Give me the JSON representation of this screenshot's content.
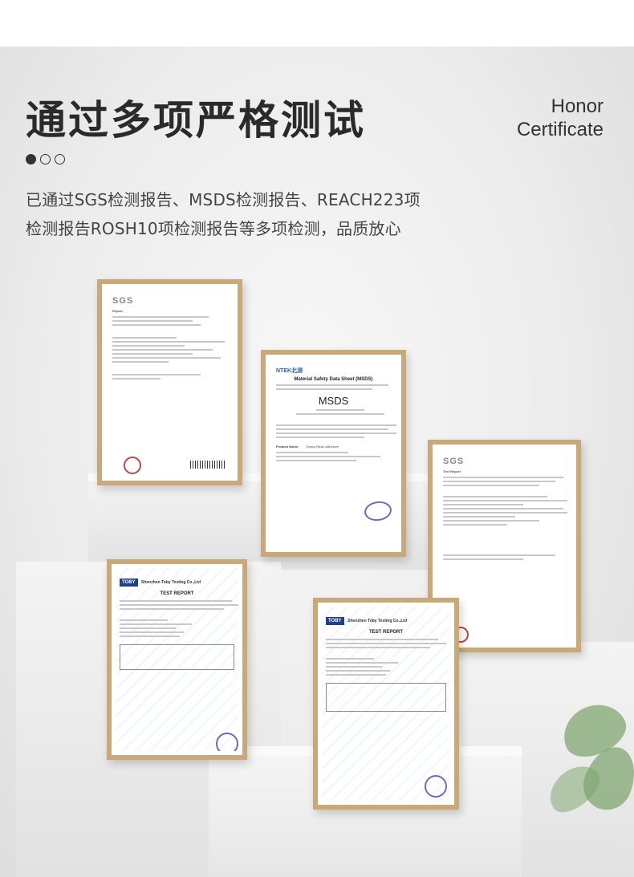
{
  "header": {
    "title": "通过多项严格测试",
    "honor_line1": "Honor",
    "honor_line2": "Certificate",
    "pagination": {
      "total": 3,
      "active": 1
    }
  },
  "description": {
    "line1": "已通过SGS检测报告、MSDS检测报告、REACH223项",
    "line2": "检测报告ROSH10项检测报告等多项检测，品质放心"
  },
  "certificates": {
    "sgs_report": {
      "logo": "SGS",
      "label": "Report"
    },
    "msds": {
      "logo": "NTEK北测",
      "heading": "Material Safety Data Sheet (MSDS)",
      "big": "MSDS",
      "product_label": "Product Name:",
      "product_value": "Epoxy Resin Adhesive"
    },
    "sgs_test": {
      "logo": "SGS",
      "label": "Test Report"
    },
    "toby_left": {
      "logo": "TOBY",
      "company": "Shenzhen Toby Testing Co.,Ltd",
      "heading": "TEST REPORT"
    },
    "toby_right": {
      "logo": "TOBY",
      "company": "Shenzhen Toby Testing Co.,Ltd",
      "heading": "TEST REPORT"
    }
  },
  "colors": {
    "frame": "#c9a978",
    "title": "#2a2a2a",
    "toby_blue": "#1f3f8f"
  }
}
